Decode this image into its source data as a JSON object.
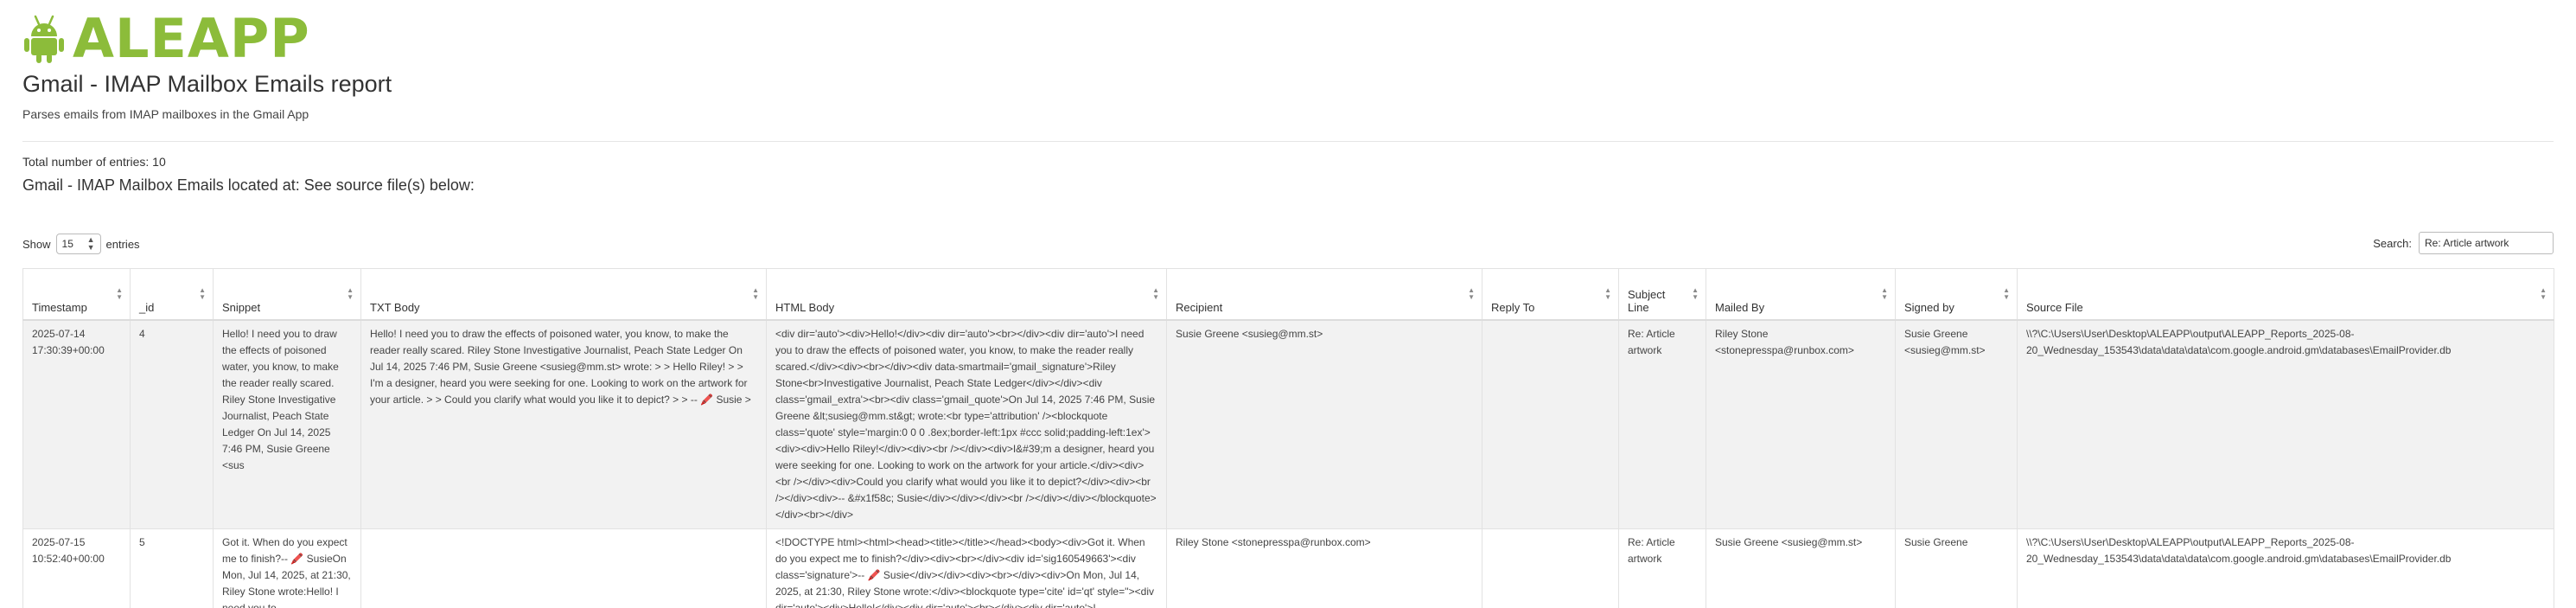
{
  "header": {
    "brand": "ALEAPP",
    "title": "Gmail - IMAP Mailbox Emails report",
    "subtitle": "Parses emails from IMAP mailboxes in the Gmail App",
    "total_entries": "Total number of entries: 10",
    "located_at": "Gmail - IMAP Mailbox Emails located at: See source file(s) below:"
  },
  "controls": {
    "show_label": "Show",
    "show_value": "15",
    "entries_label": "entries",
    "search_label": "Search:",
    "search_value": "Re: Article artwork"
  },
  "table": {
    "columns": [
      "Timestamp",
      "_id",
      "Snippet",
      "TXT Body",
      "HTML Body",
      "Recipient",
      "Reply To",
      "Subject Line",
      "Mailed By",
      "Signed by",
      "Source File"
    ],
    "rows": [
      {
        "timestamp": "2025-07-14 17:30:39+00:00",
        "id": "4",
        "snippet": "Hello! I need you to draw the effects of poisoned water, you know, to make the reader really scared. Riley Stone Investigative Journalist, Peach State Ledger On Jul 14, 2025 7:46 PM, Susie Greene <sus",
        "txt_body": "Hello! I need you to draw the effects of poisoned water, you know, to make the reader really scared. Riley Stone Investigative Journalist, Peach State Ledger On Jul 14, 2025 7:46 PM, Susie Greene <susieg@mm.st> wrote: > > Hello Riley! > > I'm a designer, heard you were seeking for one. Looking to work on the artwork for your article. > > Could you clarify what would you like it to depict? > > -- 🖍️ Susie >",
        "html_body": "<div dir='auto'><div>Hello!</div><div dir='auto'><br></div><div dir='auto'>I need you to draw the effects of poisoned water, you know, to make the reader really scared.</div><div><br></div><div data-smartmail='gmail_signature'>Riley Stone<br>Investigative Journalist, Peach State Ledger</div></div><div class='gmail_extra'><br><div class='gmail_quote'>On Jul 14, 2025 7:46 PM, Susie Greene &lt;susieg@mm.st&gt; wrote:<br type='attribution' /><blockquote class='quote' style='margin:0 0 0 .8ex;border-left:1px #ccc solid;padding-left:1ex'><div><div>Hello Riley!</div><div><br /></div><div>I&#39;m a designer, heard you were seeking for one. Looking to work on the artwork for your article.</div><div><br /></div><div>Could you clarify what would you like it to depict?</div><div><br /></div><div>-- &#x1f58c; Susie</div></div></div><br /></div></div></blockquote></div><br></div>",
        "recipient": "Susie Greene <susieg@mm.st>",
        "reply_to": "",
        "subject": "Re: Article artwork",
        "mailed_by": "Riley Stone <stonepresspa@runbox.com>",
        "signed_by": "Susie Greene <susieg@mm.st>",
        "source_file": "\\\\?\\C:\\Users\\User\\Desktop\\ALEAPP\\output\\ALEAPP_Reports_2025-08-20_Wednesday_153543\\data\\data\\data\\com.google.android.gm\\databases\\EmailProvider.db"
      },
      {
        "timestamp": "2025-07-15 10:52:40+00:00",
        "id": "5",
        "snippet": "Got it. When do you expect me to finish?-- 🖍️ SusieOn Mon, Jul 14, 2025, at 21:30, Riley Stone wrote:Hello! I need you to",
        "txt_body": "",
        "html_body": "<!DOCTYPE html><html><head><title></title></head><body><div>Got it. When do you expect me to finish?</div><div><br></div><div id='sig160549663'><div class='signature'>-- 🖍️ Susie</div></div><div><br></div><div>On Mon, Jul 14, 2025, at 21:30, Riley Stone wrote:</div><blockquote type='cite' id='qt' style=''><div dir='auto'><div>Hello!</div><div dir='auto'><br></div><div dir='auto'>I",
        "recipient": "Riley Stone <stonepresspa@runbox.com>",
        "reply_to": "",
        "subject": "Re: Article artwork",
        "mailed_by": "Susie Greene <susieg@mm.st>",
        "signed_by": "Susie Greene",
        "source_file": "\\\\?\\C:\\Users\\User\\Desktop\\ALEAPP\\output\\ALEAPP_Reports_2025-08-20_Wednesday_153543\\data\\data\\data\\com.google.android.gm\\databases\\EmailProvider.db"
      }
    ]
  },
  "colors": {
    "brand_green": "#8cbc3a",
    "row_shade": "#f2f2f2",
    "border": "#e2e2e2"
  },
  "icons": {
    "brand": "android-robot-icon",
    "sort": "sort-arrows-icon",
    "select": "up-down-icon"
  }
}
